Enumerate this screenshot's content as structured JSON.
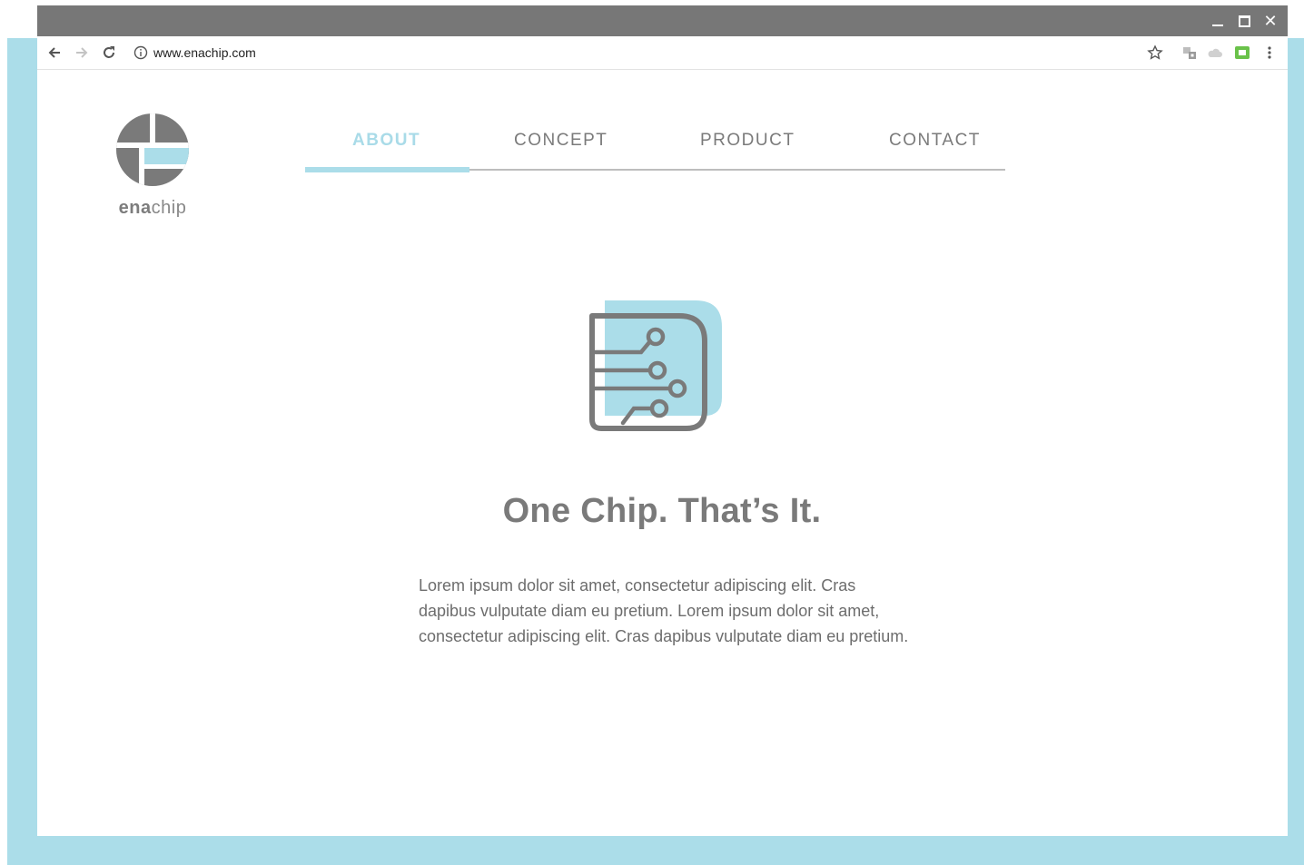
{
  "browser": {
    "url": "www.enachip.com",
    "window_controls": [
      "minimize-icon",
      "maximize-icon",
      "close-icon"
    ],
    "close_glyph": "✕"
  },
  "site": {
    "logo": {
      "brand_bold": "ena",
      "brand_light": "chip"
    },
    "nav": [
      {
        "label": "ABOUT",
        "active": true
      },
      {
        "label": "CONCEPT",
        "active": false
      },
      {
        "label": "PRODUCT",
        "active": false
      },
      {
        "label": "CONTACT",
        "active": false
      }
    ],
    "hero": {
      "headline": "One Chip. That’s It.",
      "body": "Lorem ipsum dolor sit amet, consectetur adipiscing elit. Cras dapibus vulputate diam eu pretium. Lorem ipsum dolor sit amet, consectetur adipiscing elit. Cras dapibus vulputate diam eu pretium."
    }
  },
  "colors": {
    "accent": "#abdde9",
    "gray": "#7a7a7a",
    "titlebar": "#777777"
  }
}
